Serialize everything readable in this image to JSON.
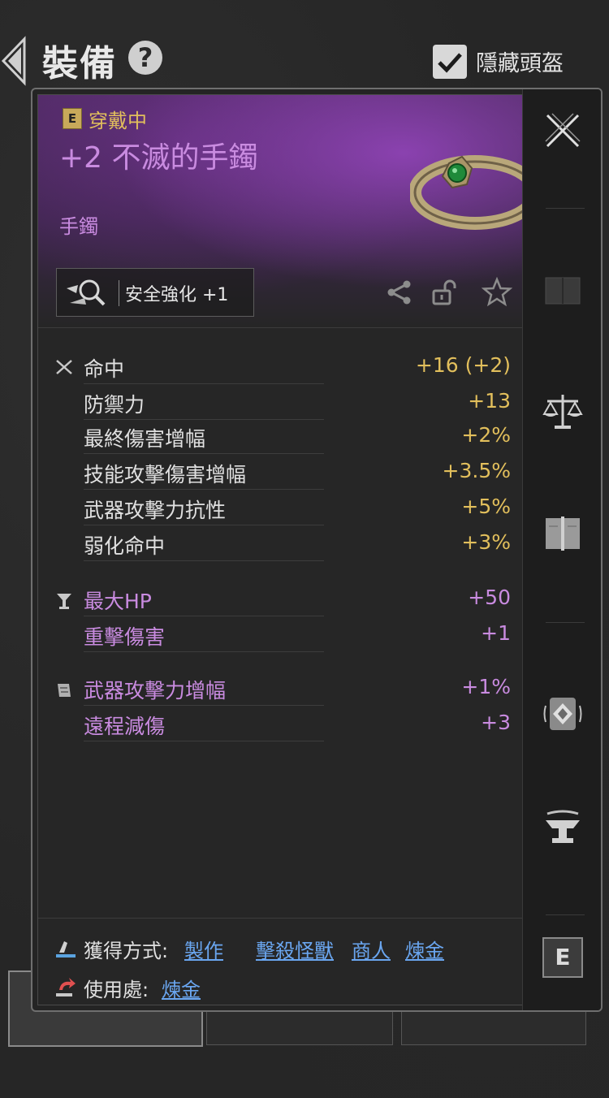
{
  "header": {
    "title": "裝備",
    "help": "?",
    "hide_helmet_label": "隱藏頭盔",
    "hide_helmet_checked": true
  },
  "item": {
    "equipped_badge": "E",
    "equipped_label": "穿戴中",
    "name": "+2 不滅的手鐲",
    "type": "手鐲",
    "enhance_label": "安全強化 +1"
  },
  "stats_main": [
    {
      "name": "命中",
      "value": "+16 (+2)"
    },
    {
      "name": "防禦力",
      "value": "+13"
    },
    {
      "name": "最終傷害增幅",
      "value": "+2%"
    },
    {
      "name": "技能攻擊傷害增幅",
      "value": "+3.5%"
    },
    {
      "name": "武器攻擊力抗性",
      "value": "+5%"
    },
    {
      "name": "弱化命中",
      "value": "+3%"
    }
  ],
  "stats_bonus1": [
    {
      "name": "最大HP",
      "value": "+50"
    },
    {
      "name": "重擊傷害",
      "value": "+1"
    }
  ],
  "stats_bonus2": [
    {
      "name": "武器攻擊力增幅",
      "value": "+1%"
    },
    {
      "name": "遠程減傷",
      "value": "+3"
    }
  ],
  "acquisition": {
    "label": "獲得方式:",
    "links": [
      "製作",
      "擊殺怪獸",
      "商人",
      "煉金"
    ]
  },
  "usage": {
    "label": "使用處:",
    "links": [
      "煉金"
    ]
  },
  "sidebar_bottom_badge": "E",
  "colors": {
    "gold": "#e2bf5c",
    "purple": "#c98be0",
    "link": "#6aa6f0"
  }
}
